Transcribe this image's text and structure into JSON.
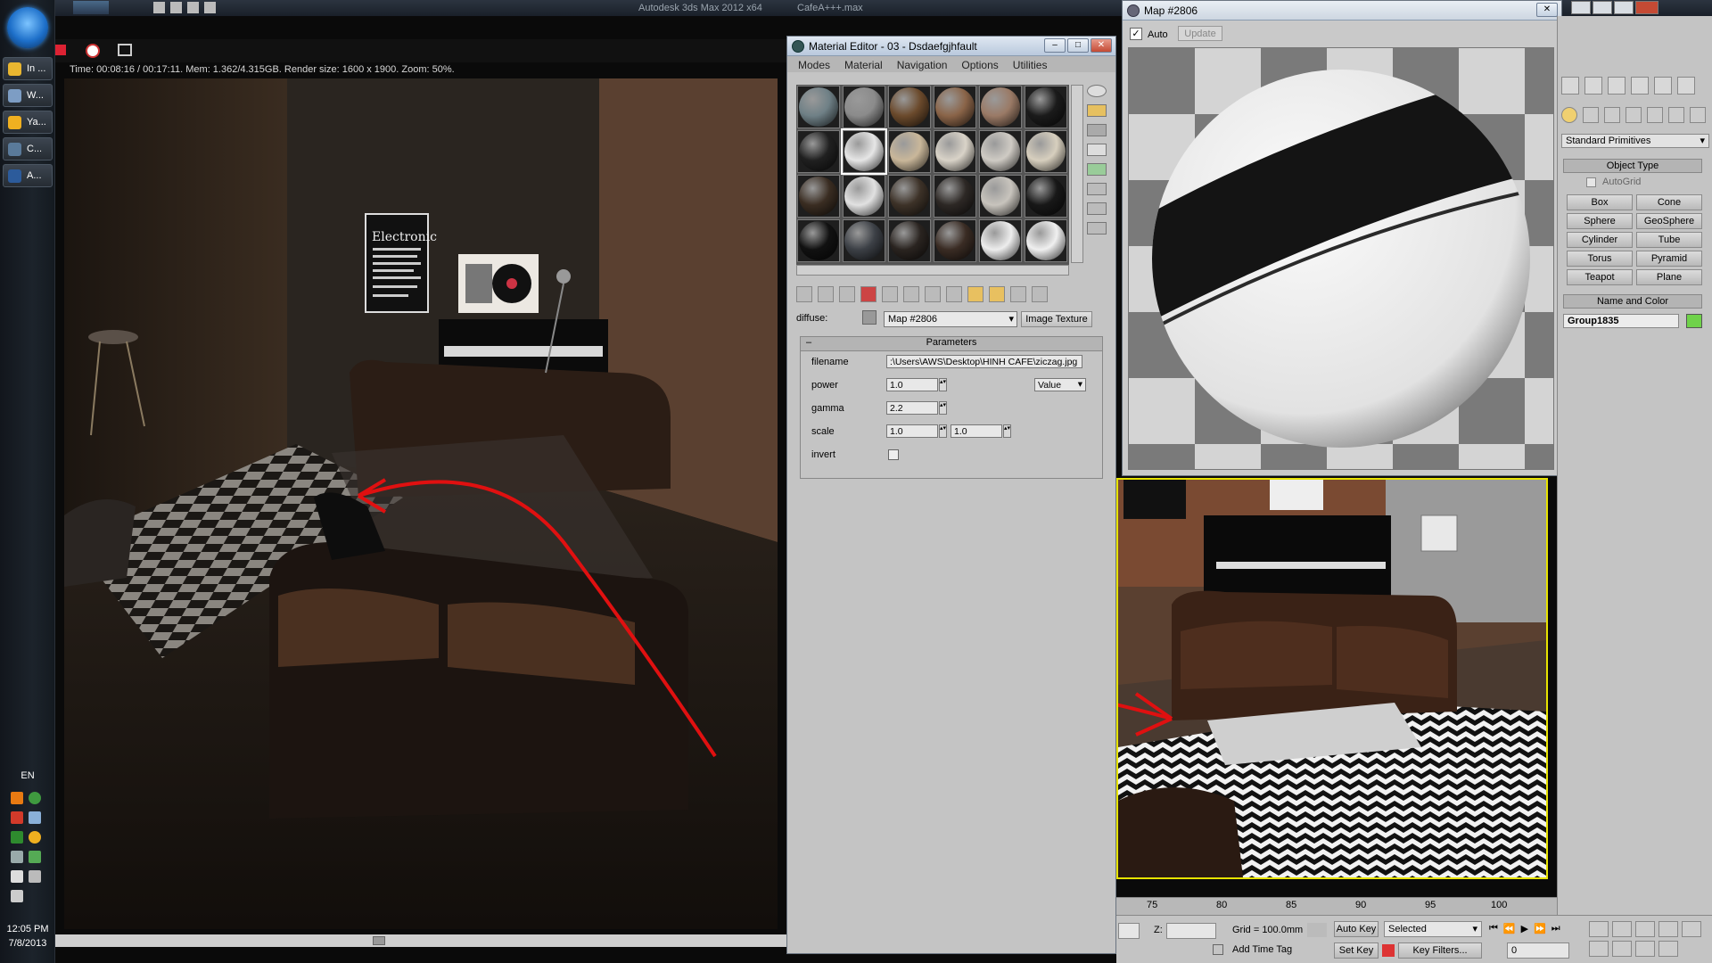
{
  "taskbar": {
    "apps": [
      {
        "label": "In ...",
        "color": "#e9b630"
      },
      {
        "label": "W...",
        "color": "#7d9dc4"
      },
      {
        "label": "Ya...",
        "color": "#f0b020"
      },
      {
        "label": "C...",
        "color": "#5a7a9a"
      },
      {
        "label": "A...",
        "color": "#2c5b9b"
      }
    ],
    "language": "EN",
    "time": "12:05 PM",
    "date": "7/8/2013"
  },
  "max_title": {
    "app": "Autodesk 3ds Max  2012 x64",
    "file": "CafeA+++.max"
  },
  "render_frame": {
    "status": "Time: 00:08:16 / 00:17:11.   Mem: 1.362/4.315GB.   Render size: 1600 x 1900.   Zoom: 50%.",
    "poster_text": "Electronic"
  },
  "material_editor": {
    "title": "Material Editor - 03 - Dsdaefgjhfault",
    "menu": [
      "Modes",
      "Material",
      "Navigation",
      "Options",
      "Utilities"
    ],
    "diffuse_label": "diffuse:",
    "map_name": "Map #2806",
    "map_type": "Image Texture",
    "rollout": "Parameters",
    "params": {
      "filename_label": "filename",
      "filename_value": ":\\Users\\AWS\\Desktop\\HINH CAFE\\ziczag.jpg",
      "power_label": "power",
      "power_value": "1.0",
      "power_mode": "Value",
      "gamma_label": "gamma",
      "gamma_value": "2.2",
      "scale_label": "scale",
      "scale_u": "1.0",
      "scale_v": "1.0",
      "invert_label": "invert"
    },
    "sphere_colors": [
      "#6f8086",
      "#8b8b8b",
      "#6b4a2c",
      "#8a6448",
      "#9a7a66",
      "#1b1b1b",
      "#202020",
      "#e6e6e6",
      "#c9b79a",
      "#d9d3c8",
      "#cfcbc4",
      "#d7cfbe",
      "#3a2d22",
      "#e1e1e1",
      "#3d3228",
      "#2d2825",
      "#c8c4bd",
      "#181818",
      "#111111",
      "#3c4046",
      "#2a2420",
      "#3a2c24",
      "#ededed",
      "#f0f0f0"
    ]
  },
  "map_window": {
    "title": "Map #2806",
    "auto_label": "Auto",
    "update_label": "Update"
  },
  "command_panel": {
    "category": "Standard Primitives",
    "object_type_header": "Object Type",
    "autogrid_label": "AutoGrid",
    "buttons": [
      "Box",
      "Cone",
      "Sphere",
      "GeoSphere",
      "Cylinder",
      "Tube",
      "Torus",
      "Pyramid",
      "Teapot",
      "Plane"
    ],
    "name_color_header": "Name and Color",
    "object_name": "Group1835",
    "object_color": "#6fd24a"
  },
  "timeline": {
    "ticks": [
      "75",
      "80",
      "85",
      "90",
      "95",
      "100"
    ]
  },
  "status_bar": {
    "z_label": "Z:",
    "grid": "Grid = 100.0mm",
    "auto_key": "Auto Key",
    "selected": "Selected",
    "set_key": "Set Key",
    "key_filters": "Key Filters...",
    "add_time_tag": "Add Time Tag",
    "frame": "0"
  }
}
